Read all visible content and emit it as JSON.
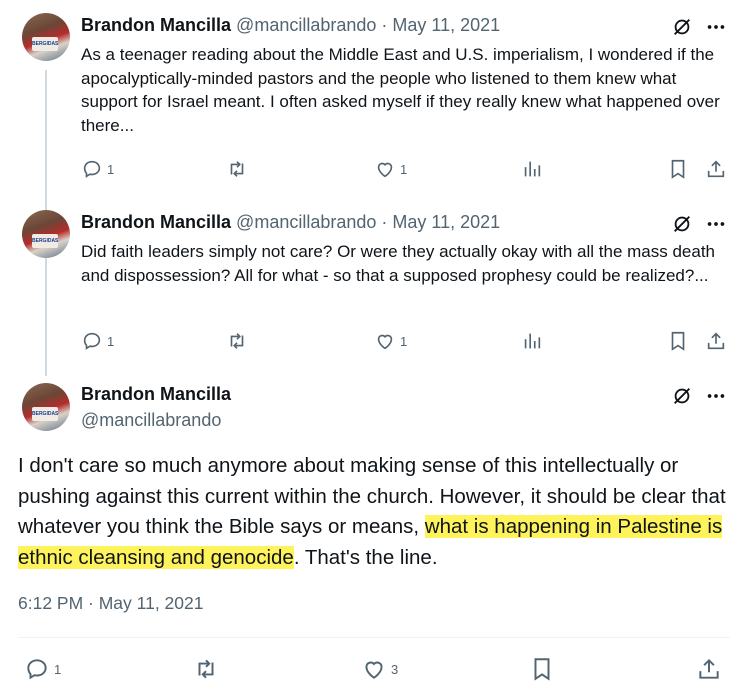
{
  "thread": [
    {
      "name": "Brandon Mancilla",
      "handle": "@mancillabrando",
      "separator": "·",
      "date": "May 11, 2021",
      "text": "As a teenager reading about the Middle East and U.S. imperialism, I wondered if the apocalyptically-minded pastors and the people who listened to them knew what support for Israel meant. I often asked myself if they really knew what happened over there...",
      "replies": "1",
      "likes": "1"
    },
    {
      "name": "Brandon Mancilla",
      "handle": "@mancillabrando",
      "separator": "·",
      "date": "May 11, 2021",
      "text": "Did faith leaders simply not care? Or were they actually okay with all the mass death and dispossession? All for what - so that a supposed prophesy could be realized?...",
      "replies": "1",
      "likes": "1"
    }
  ],
  "main": {
    "name": "Brandon Mancilla",
    "handle": "@mancillabrando",
    "text_before": "I don't care so much anymore about making sense of this intellectually or pushing against this current within the church. However, it should be clear that whatever you think the Bible says or means, ",
    "text_highlight": "what is happening in Palestine is ethnic cleansing and genocide",
    "text_after": ". That's the line.",
    "timestamp": "6:12 PM · May 11, 2021",
    "replies": "1",
    "likes": "3"
  },
  "colors": {
    "text": "#0f1419",
    "secondary": "#536471",
    "highlight": "#fff35c",
    "line": "#cfd9de"
  },
  "icons": [
    "reply-icon",
    "retweet-icon",
    "like-icon",
    "views-icon",
    "bookmark-icon",
    "share-icon",
    "grok-icon",
    "more-icon"
  ]
}
